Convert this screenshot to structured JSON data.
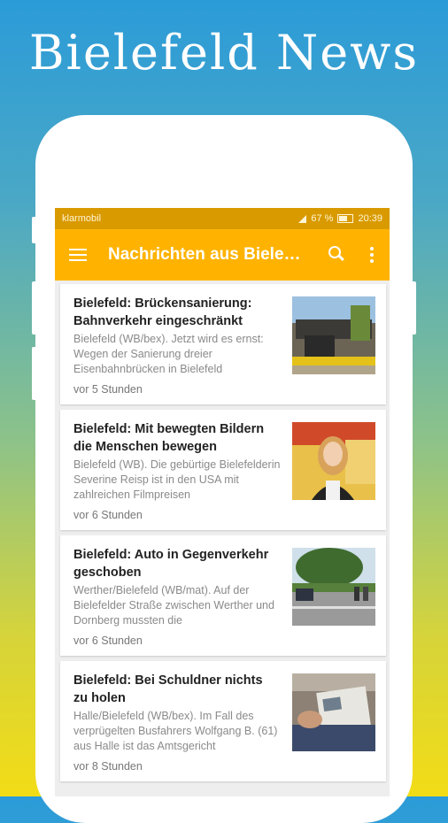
{
  "promo": {
    "title": "Bielefeld News"
  },
  "status_bar": {
    "carrier": "klarmobil",
    "battery": "67 %",
    "time": "20:39"
  },
  "app_bar": {
    "title": "Nachrichten aus Biele…",
    "menu_icon": "menu-icon",
    "search_icon": "search-icon",
    "more_icon": "more-vert-icon"
  },
  "colors": {
    "accent": "#ffb300",
    "status_bar": "#d99a00",
    "feed_bg": "#eeeeee"
  },
  "articles": [
    {
      "title": "Bielefeld: Brückensanierung: Bahnverkehr eingeschränkt",
      "text": "Bielefeld (WB/bex). Jetzt wird es ernst: Wegen der Sanierung dreier Eisenbahnbrücken in Bielefeld",
      "time": "vor 5 Stunden"
    },
    {
      "title": "Bielefeld: Mit bewegten Bildern die Menschen bewegen",
      "text": "Bielefeld (WB). Die gebürtige Bielefelderin Severine Reisp ist in den USA mit zahlreichen Filmpreisen",
      "time": "vor 6 Stunden"
    },
    {
      "title": "Bielefeld: Auto in Gegenverkehr geschoben",
      "text": "Werther/Bielefeld (WB/mat). Auf der Bielefelder Straße zwischen Werther und Dornberg mussten die",
      "time": "vor 6 Stunden"
    },
    {
      "title": "Bielefeld: Bei Schuldner nichts zu holen",
      "text": "Halle/Bielefeld (WB/bex). Im Fall des verprügelten Busfahrers Wolfgang B. (61) aus Halle ist das Amtsgericht",
      "time": "vor 8 Stunden"
    }
  ]
}
